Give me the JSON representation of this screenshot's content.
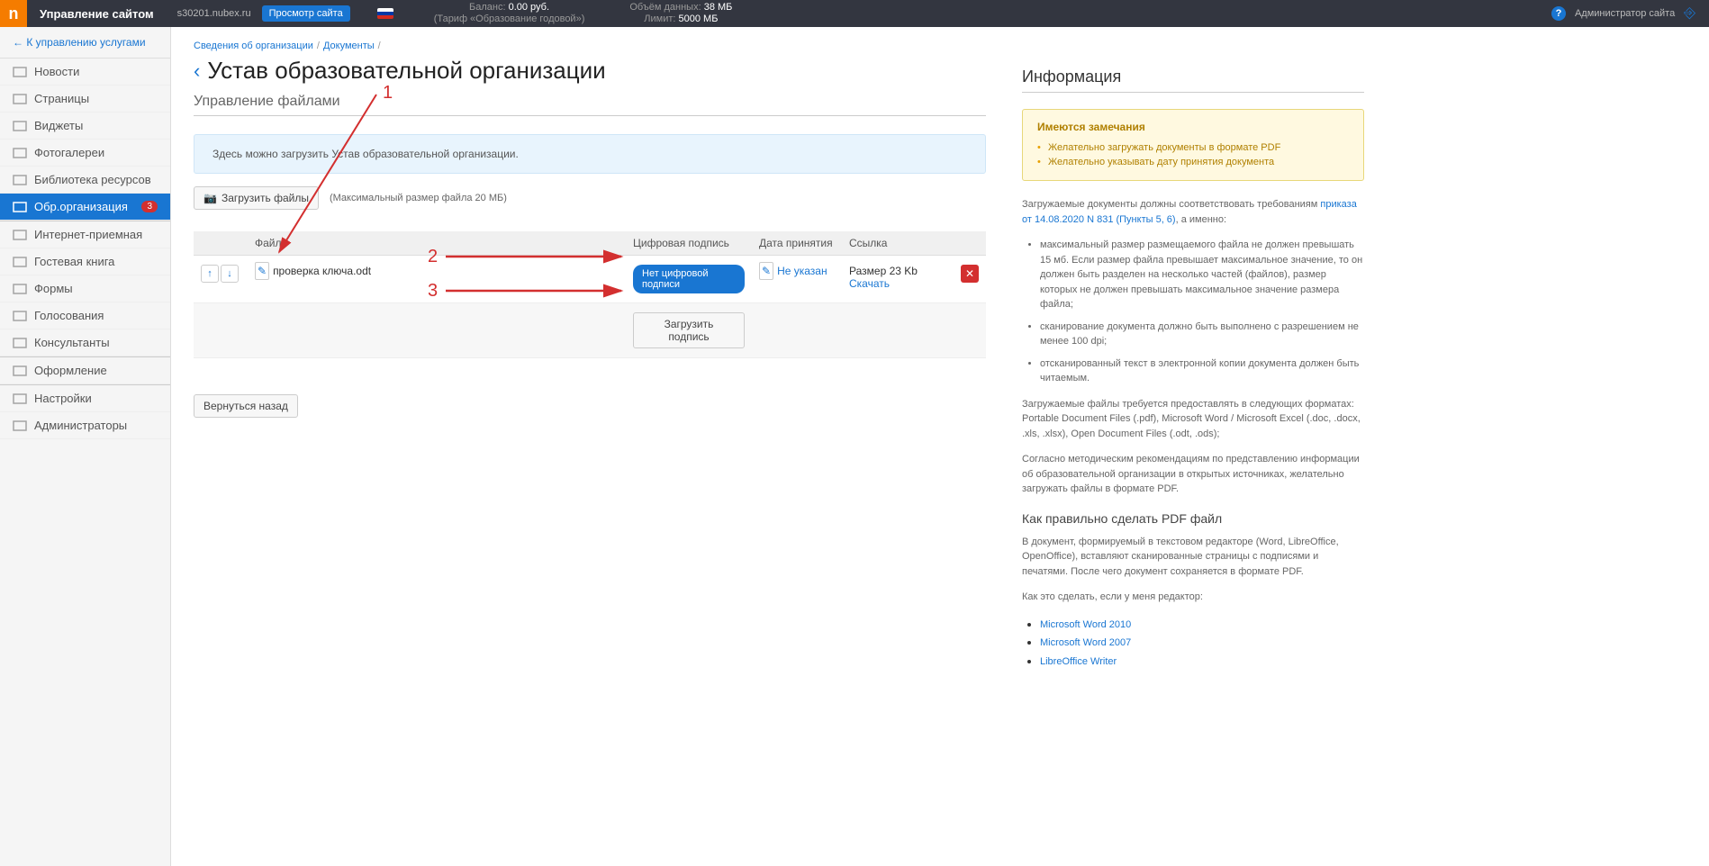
{
  "topbar": {
    "title": "Управление сайтом",
    "domain": "s30201.nubex.ru",
    "preview": "Просмотр сайта",
    "balance_label": "Баланс:",
    "balance_value": "0.00 руб.",
    "tariff": "(Тариф «Образование годовой»)",
    "data_label": "Объём данных:",
    "data_value": "38 МБ",
    "limit_label": "Лимит:",
    "limit_value": "5000 МБ",
    "admin": "Администратор сайта"
  },
  "sidebar": {
    "back": "К управлению услугами",
    "items": [
      {
        "label": "Новости"
      },
      {
        "label": "Страницы"
      },
      {
        "label": "Виджеты"
      },
      {
        "label": "Фотогалереи"
      },
      {
        "label": "Библиотека ресурсов"
      },
      {
        "label": "Обр.организация",
        "active": true,
        "badge": "3"
      },
      {
        "label": "Интернет-приемная"
      },
      {
        "label": "Гостевая книга"
      },
      {
        "label": "Формы"
      },
      {
        "label": "Голосования"
      },
      {
        "label": "Консультанты"
      },
      {
        "label": "Оформление"
      },
      {
        "label": "Настройки"
      },
      {
        "label": "Администраторы"
      }
    ]
  },
  "breadcrumb": {
    "a": "Сведения об организации",
    "b": "Документы"
  },
  "page": {
    "title": "Устав образовательной организации",
    "subsection": "Управление файлами",
    "notice": "Здесь можно загрузить Устав образовательной организации.",
    "upload_btn": "Загрузить файлы",
    "upload_hint": "(Максимальный размер файла 20 МБ)",
    "back_btn": "Вернуться назад"
  },
  "table": {
    "headers": {
      "file": "Файл",
      "sig": "Цифровая подпись",
      "date": "Дата принятия",
      "link": "Ссылка"
    },
    "filename": "проверка ключа.odt",
    "no_sig": "Нет цифровой подписи",
    "no_date": "Не указан",
    "size": "Размер 23 Kb",
    "download": "Скачать",
    "upload_sig": "Загрузить подпись"
  },
  "info": {
    "title": "Информация",
    "warn_title": "Имеются замечания",
    "warn1": "Желательно загружать документы в формате PDF",
    "warn2": "Желательно указывать дату принятия документа",
    "req_intro_a": "Загружаемые документы должны соответствовать требованиям ",
    "req_link": "приказа от 14.08.2020 N 831 (Пункты 5, 6)",
    "req_intro_b": ", а именно:",
    "req1": "максимальный размер размещаемого файла не должен превышать 15 мб. Если размер файла превышает максимальное значение, то он должен быть разделен на несколько частей (файлов), размер которых не должен превышать максимальное значение размера файла;",
    "req2": "сканирование документа должно быть выполнено с разрешением не менее 100 dpi;",
    "req3": "отсканированный текст в электронной копии документа должен быть читаемым.",
    "formats": "Загружаемые файлы требуется предоставлять в следующих форматах: Portable Document Files (.pdf), Microsoft Word / Microsoft Excel (.doc, .docx, .xls, .xlsx), Open Document Files (.odt, .ods);",
    "method": "Согласно методическим рекомендациям по представлению информации об образовательной организации в открытых источниках, желательно загружать файлы в формате PDF.",
    "pdf_title": "Как правильно сделать PDF файл",
    "pdf_desc": "В документ, формируемый в текстовом редакторе (Word, LibreOffice, OpenOffice), вставляют сканированные страницы с подписями и печатями. После чего документ сохраняется в формате PDF.",
    "pdf_howto": "Как это сделать, если у меня редактор:",
    "pdf_links": [
      "Microsoft Word 2010",
      "Microsoft Word 2007",
      "LibreOffice Writer"
    ]
  },
  "annotations": {
    "n1": "1",
    "n2": "2",
    "n3": "3"
  }
}
